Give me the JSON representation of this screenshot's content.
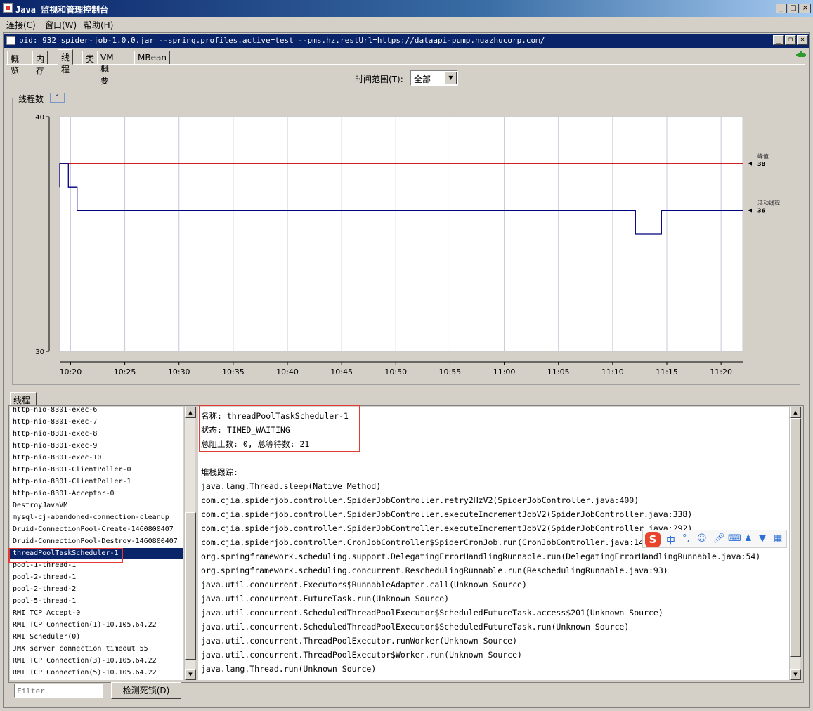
{
  "window": {
    "title": "Java 监视和管理控制台",
    "controls": [
      "_",
      "□",
      "×"
    ]
  },
  "menu": [
    "连接(C)",
    "窗口(W)",
    "帮助(H)"
  ],
  "connection": {
    "title": "pid: 932 spider-job-1.0.0.jar --spring.profiles.active=test --pms.hz.restUrl=https://dataapi-pump.huazhucorp.com/"
  },
  "tabs": [
    "概览",
    "内存",
    "线程",
    "类",
    "VM 概要",
    "MBean"
  ],
  "active_tab": "线程",
  "time_range": {
    "label": "时间范围(T):",
    "value": "全部"
  },
  "thread_count_panel": {
    "title": "线程数",
    "collapse": "⌃"
  },
  "chart_data": {
    "type": "line",
    "title": "线程数",
    "ylim": [
      30,
      40
    ],
    "y_ticks": [
      "40",
      "30"
    ],
    "x_ticks": [
      "10:20",
      "10:25",
      "10:30",
      "10:35",
      "10:40",
      "10:45",
      "10:50",
      "10:55",
      "11:00",
      "11:05",
      "11:10",
      "11:15",
      "11:20"
    ],
    "series": [
      {
        "name": "峰值",
        "color": "#cc0000",
        "value_label": "38",
        "points": [
          [
            "10:19",
            38
          ],
          [
            "11:22",
            38
          ]
        ]
      },
      {
        "name": "活动线程",
        "color": "#000080",
        "value_label": "36",
        "points": [
          [
            "10:19",
            37
          ],
          [
            "10:19",
            38
          ],
          [
            "10:19.8",
            38
          ],
          [
            "10:19.8",
            37
          ],
          [
            "10:20.6",
            37
          ],
          [
            "10:20.6",
            36
          ],
          [
            "11:12.1",
            36
          ],
          [
            "11:12.1",
            35
          ],
          [
            "11:14.5",
            35
          ],
          [
            "11:14.5",
            36
          ],
          [
            "11:22",
            36
          ]
        ]
      }
    ]
  },
  "threads_tab": "线程",
  "thread_list": [
    "http-nio-8301-exec-6",
    "http-nio-8301-exec-7",
    "http-nio-8301-exec-8",
    "http-nio-8301-exec-9",
    "http-nio-8301-exec-10",
    "http-nio-8301-ClientPoller-0",
    "http-nio-8301-ClientPoller-1",
    "http-nio-8301-Acceptor-0",
    "DestroyJavaVM",
    "mysql-cj-abandoned-connection-cleanup",
    "Druid-ConnectionPool-Create-1460800407",
    "Druid-ConnectionPool-Destroy-1460800407",
    "threadPoolTaskScheduler-1",
    "pool-1-thread-1",
    "pool-2-thread-1",
    "pool-2-thread-2",
    "pool-5-thread-1",
    "RMI TCP Accept-0",
    "RMI TCP Connection(1)-10.105.64.22",
    "RMI Scheduler(0)",
    "JMX server connection timeout 55",
    "RMI TCP Connection(3)-10.105.64.22",
    "RMI TCP Connection(5)-10.105.64.22"
  ],
  "selected_thread_index": 12,
  "detail": {
    "name_line": "名称: threadPoolTaskScheduler-1",
    "state_line": "状态: TIMED_WAITING",
    "blocked_line": "总阻止数: 0, 总等待数: 21",
    "stack_header": "堆栈跟踪:",
    "stack": [
      "java.lang.Thread.sleep(Native Method)",
      "com.cjia.spiderjob.controller.SpiderJobController.retry2HzV2(SpiderJobController.java:400)",
      "com.cjia.spiderjob.controller.SpiderJobController.executeIncrementJobV2(SpiderJobController.java:338)",
      "com.cjia.spiderjob.controller.SpiderJobController.executeIncrementJobV2(SpiderJobController.java:292)",
      "com.cjia.spiderjob.controller.CronJobController$SpiderCronJob.run(CronJobController.java:14",
      "org.springframework.scheduling.support.DelegatingErrorHandlingRunnable.run(DelegatingErrorHandlingRunnable.java:54)",
      "org.springframework.scheduling.concurrent.ReschedulingRunnable.run(ReschedulingRunnable.java:93)",
      "java.util.concurrent.Executors$RunnableAdapter.call(Unknown Source)",
      "java.util.concurrent.FutureTask.run(Unknown Source)",
      "java.util.concurrent.ScheduledThreadPoolExecutor$ScheduledFutureTask.access$201(Unknown Source)",
      "java.util.concurrent.ScheduledThreadPoolExecutor$ScheduledFutureTask.run(Unknown Source)",
      "java.util.concurrent.ThreadPoolExecutor.runWorker(Unknown Source)",
      "java.util.concurrent.ThreadPoolExecutor$Worker.run(Unknown Source)",
      "java.lang.Thread.run(Unknown Source)"
    ]
  },
  "filter_placeholder": "Filter",
  "detect_deadlock_button": "检测死锁(D)",
  "ime_toolbar": {
    "logo": "S",
    "items": [
      "中",
      "°,",
      "☺",
      "mic-icon",
      "keyboard-icon",
      "user-icon",
      "shirt-icon",
      "grid-icon"
    ]
  },
  "colors": {
    "selection": "#0a246a",
    "highlight_box": "#e53935",
    "peak_line": "#cc0000",
    "live_line": "#000080"
  }
}
